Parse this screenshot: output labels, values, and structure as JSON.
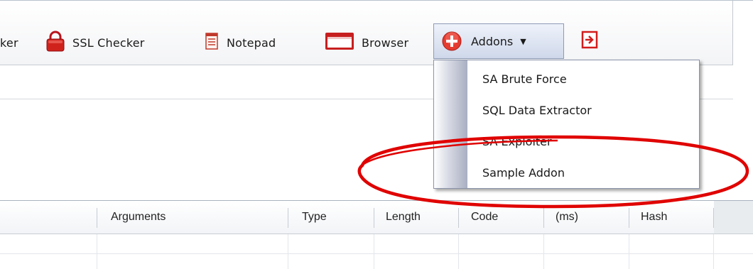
{
  "toolbar": {
    "partial_label": "ker",
    "ssl_label": "SSL Checker",
    "notepad_label": "Notepad",
    "browser_label": "Browser",
    "addons_label": "Addons",
    "icons": {
      "ssl": "lock-icon",
      "notepad": "notepad-icon",
      "browser": "browser-window-icon",
      "addons": "plus-circle-icon",
      "exit": "exit-icon"
    }
  },
  "addons_menu": {
    "items": [
      {
        "label": "SA Brute Force"
      },
      {
        "label": "SQL Data Extractor"
      },
      {
        "label": "SA Exploiter"
      },
      {
        "label": "Sample Addon"
      }
    ]
  },
  "grid": {
    "columns": [
      {
        "label": "Arguments"
      },
      {
        "label": "Type"
      },
      {
        "label": "Length"
      },
      {
        "label": "Code"
      },
      {
        "label": "(ms)"
      },
      {
        "label": "Hash"
      }
    ]
  },
  "colors": {
    "annotation": "#e00000",
    "lock": "#d0221c",
    "addons_icon": "#e53b30"
  }
}
